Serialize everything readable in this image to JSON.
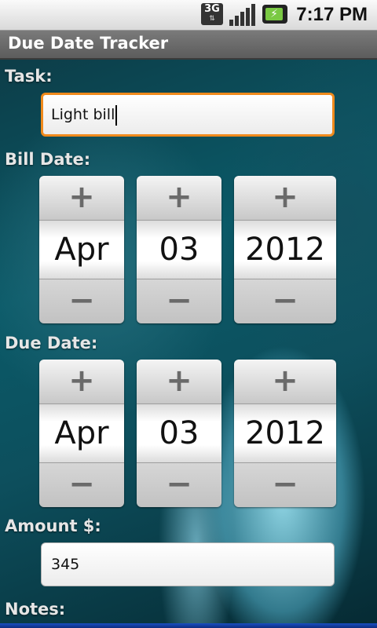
{
  "status_bar": {
    "network": "3G",
    "time": "7:17 PM",
    "icons": [
      "3g-data-icon",
      "signal-strength-icon",
      "battery-charging-icon"
    ]
  },
  "app": {
    "title": "Due Date Tracker"
  },
  "form": {
    "task_label": "Task:",
    "task_value": "Light bill",
    "bill_date_label": "Bill Date:",
    "bill_date": {
      "month": "Apr",
      "day": "03",
      "year": "2012"
    },
    "due_date_label": "Due Date:",
    "due_date": {
      "month": "Apr",
      "day": "03",
      "year": "2012"
    },
    "amount_label": "Amount $:",
    "amount_value": "345",
    "notes_label": "Notes:"
  },
  "picker_glyphs": {
    "plus": "+",
    "minus": "−"
  },
  "colors": {
    "focus_border": "#f08a1c",
    "title_bar": "#666666"
  }
}
